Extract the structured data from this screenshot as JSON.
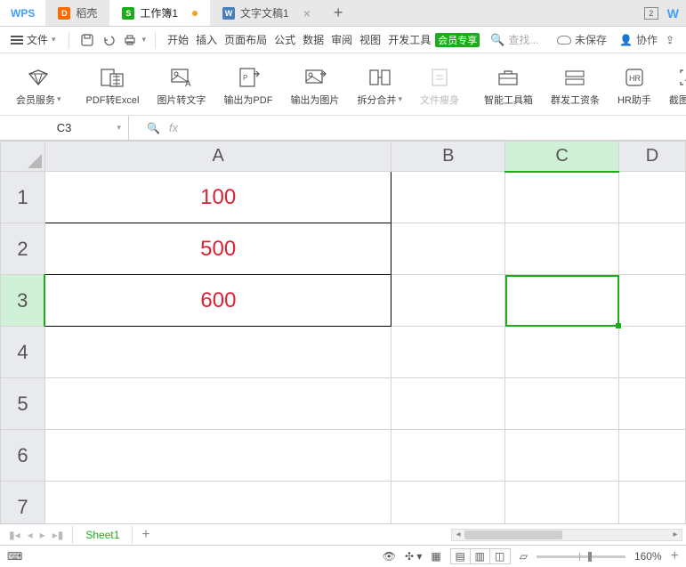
{
  "app": {
    "brand": "WPS"
  },
  "tabs": [
    {
      "icon": "doker",
      "glyph": "D",
      "label": "稻壳"
    },
    {
      "icon": "sheet",
      "glyph": "S",
      "label": "工作簿1",
      "active": true,
      "dirty": true
    },
    {
      "icon": "word",
      "glyph": "W",
      "label": "文字文稿1",
      "closable": true
    }
  ],
  "topRight": {
    "box": "2"
  },
  "menu": {
    "file": "文件",
    "tabs": [
      "开始",
      "插入",
      "页面布局",
      "公式",
      "数据",
      "审阅",
      "视图",
      "开发工具"
    ],
    "vip": "会员专享",
    "searchPlaceholder": "查找...",
    "unsaved": "未保存",
    "collab": "协作"
  },
  "ribbon": [
    {
      "label": "会员服务",
      "caret": true
    },
    {
      "label": "PDF转Excel"
    },
    {
      "label": "图片转文字"
    },
    {
      "label": "输出为PDF"
    },
    {
      "label": "输出为图片"
    },
    {
      "label": "拆分合并",
      "caret": true
    },
    {
      "label": "文件瘦身",
      "disabled": true
    },
    {
      "label": "智能工具箱"
    },
    {
      "label": "群发工资条"
    },
    {
      "label": "HR助手"
    },
    {
      "label": "截图取字"
    }
  ],
  "nameBox": "C3",
  "fx": "fx",
  "columns": [
    "A",
    "B",
    "C",
    "D"
  ],
  "rows": [
    "1",
    "2",
    "3",
    "4",
    "5",
    "6",
    "7"
  ],
  "cells": {
    "A1": "100",
    "A2": "500",
    "A3": "600"
  },
  "activeCell": {
    "col": "C",
    "row": "3"
  },
  "sheetTabs": {
    "active": "Sheet1"
  },
  "status": {
    "zoom": "160%"
  },
  "chart_data": {
    "type": "table",
    "columns": [
      "A"
    ],
    "rows": [
      {
        "A": 100
      },
      {
        "A": 500
      },
      {
        "A": 600
      }
    ]
  }
}
